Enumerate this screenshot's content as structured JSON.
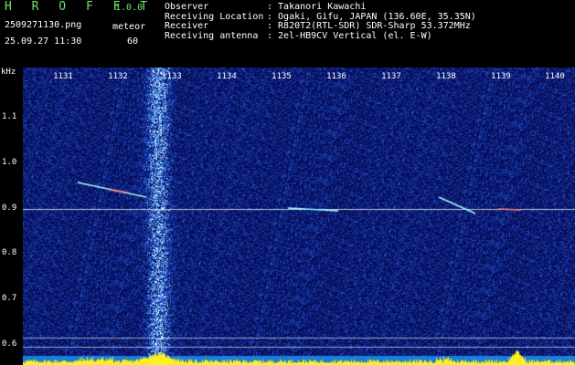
{
  "header": {
    "logo": "H R O F F T",
    "version": "1.0.0",
    "filename": "2509271130.png",
    "mode": "meteor",
    "datetime": "25.09.27 11:30",
    "count": "60",
    "info": [
      {
        "key": "Observer",
        "value": ": Takanori Kawachi"
      },
      {
        "key": "Receiving Location",
        "value": ": Ogaki, Gifu, JAPAN (136.60E, 35.35N)"
      },
      {
        "key": "Receiver",
        "value": ": R820T2(RTL-SDR) SDR-Sharp 53.372MHz"
      },
      {
        "key": "Receiving antenna",
        "value": ": 2el-HB9CV Vertical (el. E-W)"
      }
    ]
  },
  "axes": {
    "y_unit": "kHz",
    "y_ticks": [
      "1.1",
      "1.0",
      "0.9",
      "0.8",
      "0.7",
      "0.6"
    ],
    "x_ticks": [
      "1131",
      "1132",
      "1133",
      "1134",
      "1135",
      "1136",
      "1137",
      "1138",
      "1139",
      "1140"
    ]
  },
  "colors": {
    "background": "#0a1060",
    "noise": "#2a5bd8",
    "carrier": "#ffffff",
    "power_bar": "#ffee22",
    "trace": "#9ffcff"
  }
}
